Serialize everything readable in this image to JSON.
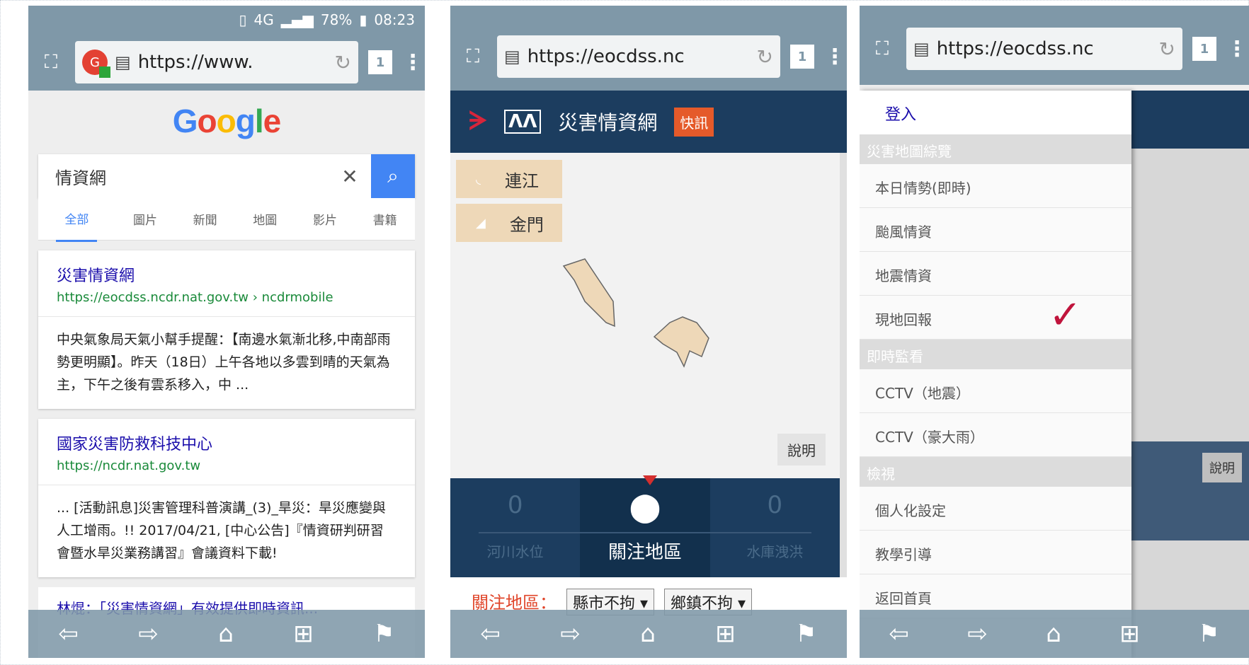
{
  "p1": {
    "status": {
      "network": "4G",
      "battery": "78%",
      "time": "08:23"
    },
    "url": "https://www.",
    "tab_count": "1",
    "logo": [
      "G",
      "o",
      "o",
      "g",
      "l",
      "e"
    ],
    "logo_colors": [
      "#4285f4",
      "#ea4335",
      "#fbbc05",
      "#4285f4",
      "#34a853",
      "#ea4335"
    ],
    "query": "情資網",
    "tabs": [
      "全部",
      "圖片",
      "新聞",
      "地圖",
      "影片",
      "書籍"
    ],
    "results": [
      {
        "title": "災害情資網",
        "url": "https://eocdss.ncdr.nat.gov.tw › ncdrmobile",
        "snippet": "中央氣象局天氣小幫手提醒：【南邊水氣漸北移,中南部雨勢更明顯】。昨天（18日）上午各地以多雲到晴的天氣為主，下午之後有雲系移入，中 ..."
      },
      {
        "title": "國家災害防救科技中心",
        "url": "https://ncdr.nat.gov.tw",
        "snippet": "... [活動訊息]災害管理科普演講_(3)_旱災：旱災應變與人工增雨。!! 2017/04/21, [中心公告]『情資研判研習會暨水旱災業務講習』會議資料下載!"
      }
    ],
    "cut_text": "林焜：「災害情資網」有效提供即時資訊..."
  },
  "p2": {
    "url": "https://eocdss.nc",
    "tab_count": "1",
    "site_title": "災害情資網",
    "badge": "快訊",
    "regions": [
      "連江",
      "金門"
    ],
    "help": "說明",
    "stats": [
      {
        "num": "0",
        "label": "河川水位"
      },
      {
        "num": "",
        "label": "關注地區"
      },
      {
        "num": "0",
        "label": "水庫洩洪"
      }
    ],
    "filter_label": "關注地區：",
    "filter_county": "縣市不拘 ▾",
    "filter_town": "鄉鎮不拘 ▾"
  },
  "p3": {
    "url": "https://eocdss.nc",
    "tab_count": "1",
    "login": "登入",
    "sections": [
      {
        "title": "災害地圖綜覽",
        "items": [
          "本日情勢(即時)",
          "颱風情資",
          "地震情資",
          "現地回報"
        ]
      },
      {
        "title": "即時監看",
        "items": [
          "CCTV（地震）",
          "CCTV（豪大雨）"
        ]
      },
      {
        "title": "檢視",
        "items": [
          "個人化設定",
          "教學引導",
          "返回首頁"
        ]
      }
    ],
    "help": "說明"
  },
  "nav_icons": [
    "back-icon",
    "forward-icon",
    "home-icon",
    "tabs-icon",
    "bookmark-icon"
  ]
}
